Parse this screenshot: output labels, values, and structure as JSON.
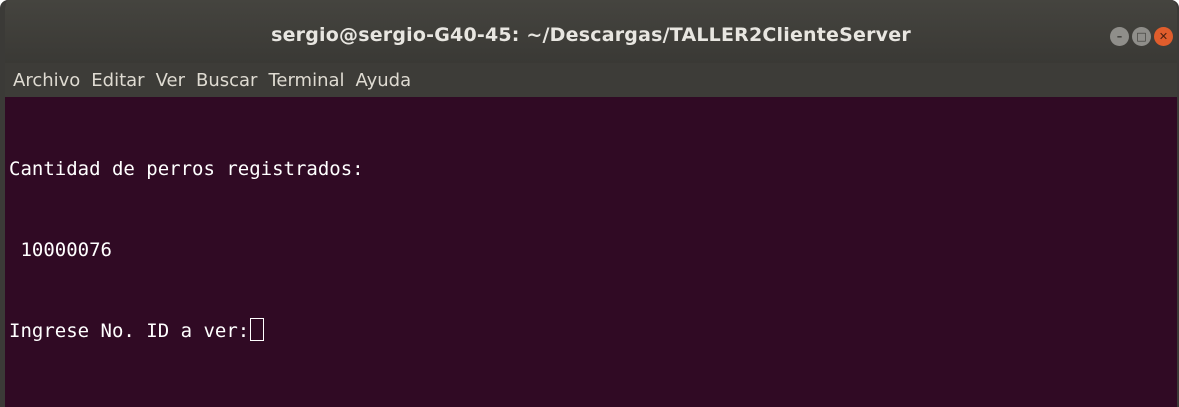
{
  "window": {
    "title": "sergio@sergio-G40-45: ~/Descargas/TALLER2ClienteServer"
  },
  "menu": {
    "items": [
      "Archivo",
      "Editar",
      "Ver",
      "Buscar",
      "Terminal",
      "Ayuda"
    ]
  },
  "terminal": {
    "lines": [
      "Cantidad de perros registrados:",
      " 10000076",
      "Ingrese No. ID a ver:"
    ]
  },
  "icons": {
    "minimize": "minimize-icon",
    "maximize": "maximize-icon",
    "close": "close-icon"
  },
  "colors": {
    "terminal_bg": "#300a24",
    "titlebar_bg": "#3a3935",
    "close_button": "#e05d2c",
    "text": "#ffffff"
  }
}
